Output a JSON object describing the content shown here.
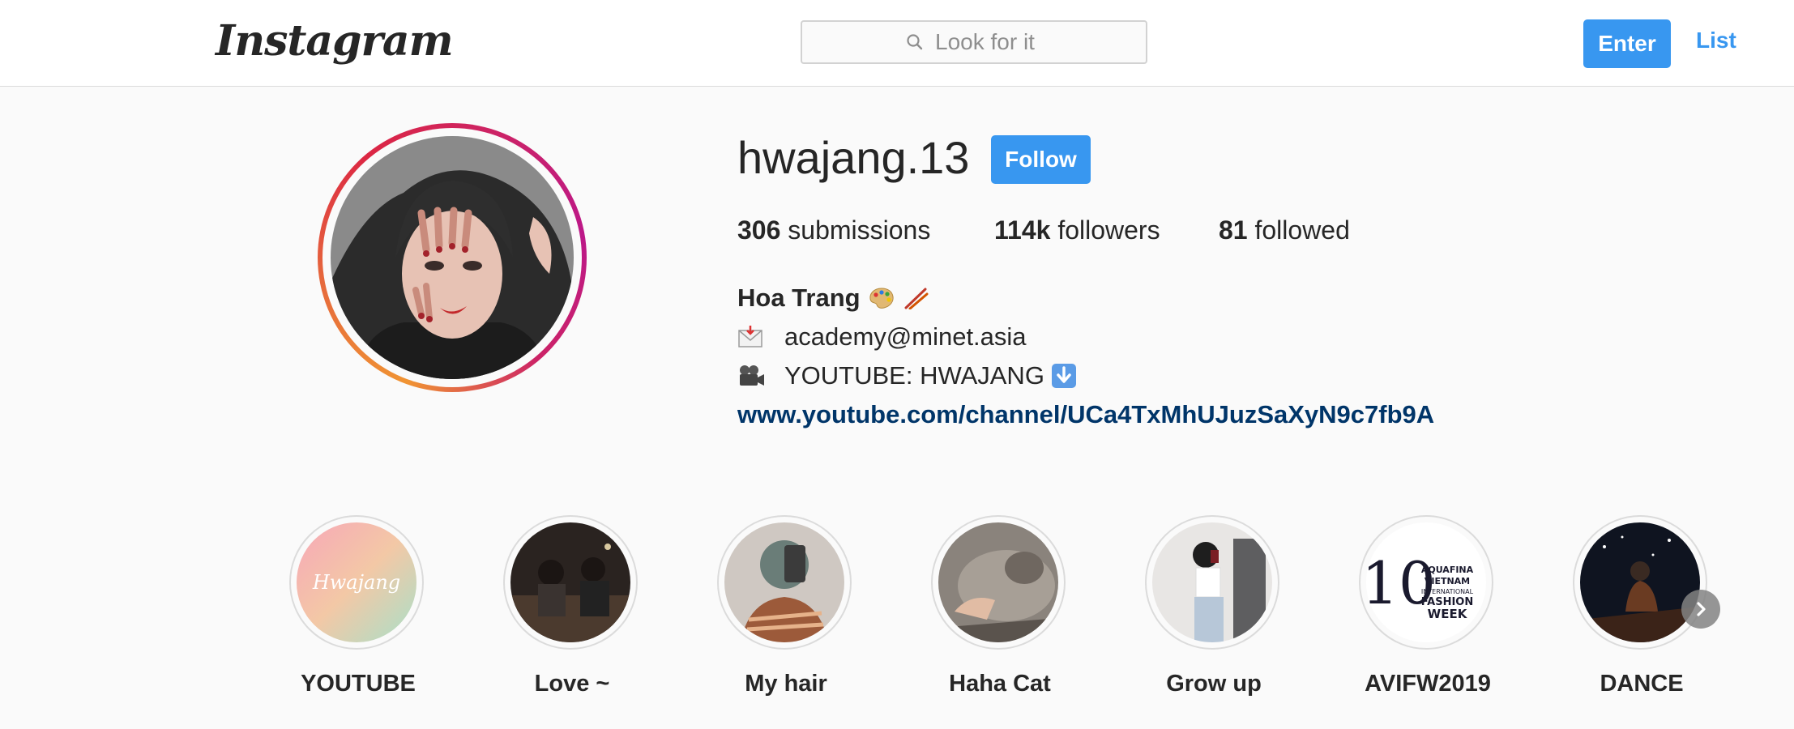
{
  "header": {
    "logo_text": "Instagram",
    "search_placeholder": "Look for it",
    "enter_label": "Enter",
    "list_label": "List"
  },
  "profile": {
    "username": "hwajang.13",
    "follow_label": "Follow",
    "stats": [
      {
        "count": "306",
        "label": "submissions"
      },
      {
        "count": "114k",
        "label": "followers"
      },
      {
        "count": "81",
        "label": "followed"
      }
    ],
    "bio": {
      "name": "Hoa Trang",
      "email": "academy@minet.asia",
      "youtube": "YOUTUBE: HWAJANG",
      "link": "www.youtube.com/channel/UCa4TxMhUJuzSaXyN9c7fb9A"
    }
  },
  "highlights": [
    {
      "label": "YOUTUBE",
      "cover_text": "Hwajang"
    },
    {
      "label": "Love ~"
    },
    {
      "label": "My hair"
    },
    {
      "label": "Haha Cat"
    },
    {
      "label": "Grow up"
    },
    {
      "label": "AVIFW2019",
      "cover_text": "10 AQUAFINA VIETNAM INTERNATIONAL FASHION WEEK"
    },
    {
      "label": "DANCE"
    }
  ],
  "colors": {
    "accent": "#3897f0",
    "link": "#003569",
    "text": "#262626",
    "background": "#fafafa"
  }
}
